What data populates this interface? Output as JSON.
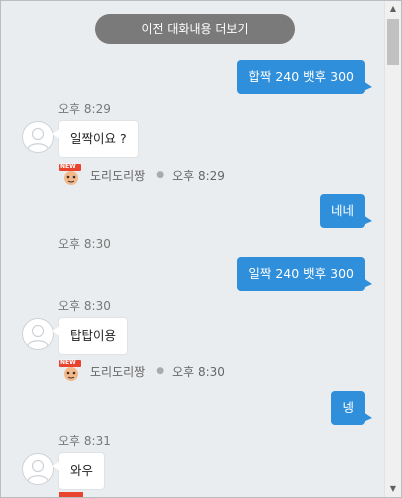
{
  "load_more_label": "이전 대화내용 더보기",
  "messages": {
    "m1": {
      "text": "합짝 240 뱃후 300"
    },
    "m2": {
      "time": "오후 8:29",
      "text": "일짝이요 ?",
      "sender": "도리도리짱",
      "sender_time": "오후 8:29"
    },
    "m3": {
      "text": "네네"
    },
    "m4": {
      "time": "오후 8:30",
      "text": "일짝 240 뱃후 300"
    },
    "m5": {
      "time": "오후 8:30",
      "text": "탑탑이용",
      "sender": "도리도리짱",
      "sender_time": "오후 8:30"
    },
    "m6": {
      "text": "넹"
    },
    "m7": {
      "time": "오후 8:31",
      "text": "와우"
    }
  },
  "badge_text": "NEW",
  "scroll_arrows": {
    "up": "▲",
    "down": "▼"
  },
  "colors": {
    "outgoing": "#2f8fdb",
    "background": "#eaedf0",
    "load_more": "#7a7a7a"
  }
}
